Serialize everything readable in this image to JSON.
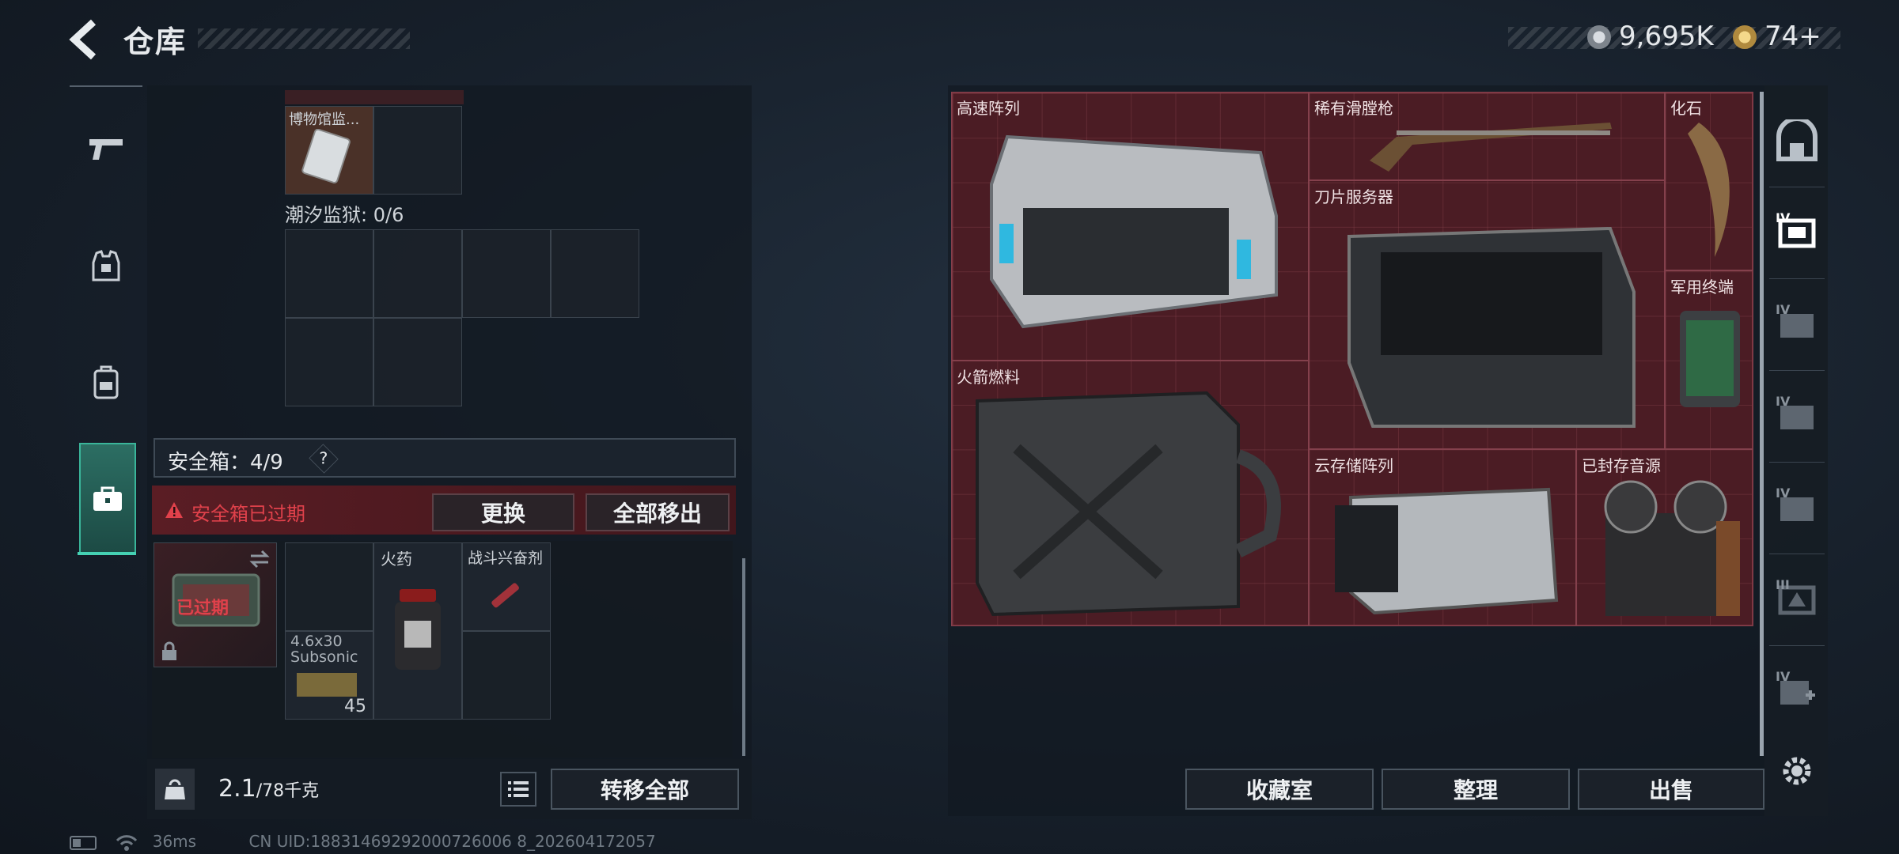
{
  "header": {
    "title": "仓库",
    "currency_primary": "9,695K",
    "currency_secondary": "74+"
  },
  "left_panel": {
    "museum_item_label": "博物馆监...",
    "tide_prison_label": "潮汐监狱: 0/6",
    "safe_box_label": "安全箱：4/9",
    "safe_help": "?",
    "expired_warning": "安全箱已过期",
    "replace_button": "更换",
    "remove_all_button": "全部移出",
    "case_status": "已过期",
    "items": [
      {
        "name": "火药"
      },
      {
        "name": "战斗兴奋剂"
      },
      {
        "name": "4.6x30 Subsonic",
        "count": "45"
      }
    ],
    "weight_value": "2.1",
    "weight_max": "/78千克",
    "transfer_all_button": "转移全部"
  },
  "right_panel": {
    "items": [
      {
        "name": "高速阵列"
      },
      {
        "name": "稀有滑膛枪"
      },
      {
        "name": "化石"
      },
      {
        "name": "刀片服务器"
      },
      {
        "name": "军用终端"
      },
      {
        "name": "火箭燃料"
      },
      {
        "name": "云存储阵列"
      },
      {
        "name": "已封存音源"
      }
    ],
    "collection_button": "收藏室",
    "sort_button": "整理",
    "sell_button": "出售",
    "tab_levels": [
      "IV",
      "IV",
      "IV",
      "IV",
      "III",
      "IV"
    ]
  },
  "footer": {
    "ping": "36ms",
    "uid": "CN UID:18831469292000726006 8_202604172057"
  },
  "colors": {
    "accent_teal": "#3ab59a",
    "warning_red": "#e0414b",
    "grid_red": "#4b1c24"
  }
}
